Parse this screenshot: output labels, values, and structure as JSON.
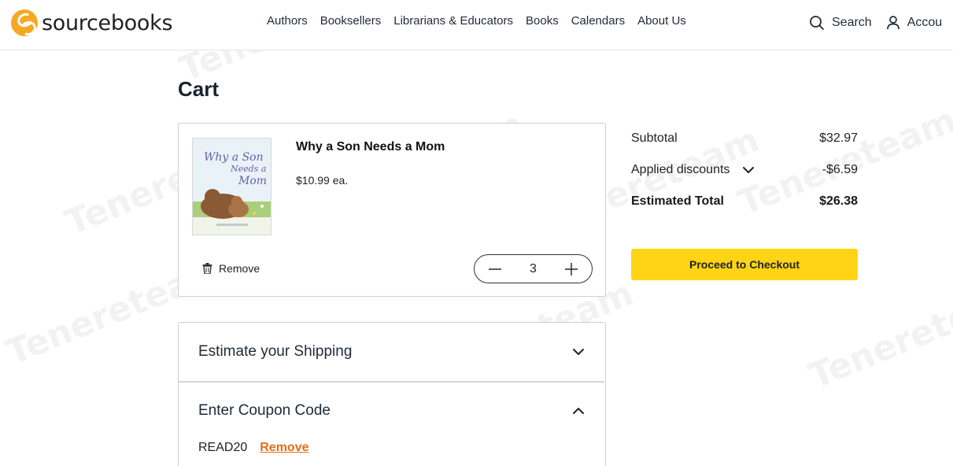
{
  "header": {
    "brand": "sourcebooks",
    "nav": [
      "Authors",
      "Booksellers",
      "Librarians & Educators",
      "Books",
      "Calendars",
      "About Us"
    ],
    "search_label": "Search",
    "account_label": "Accou"
  },
  "page": {
    "title": "Cart"
  },
  "cart_item": {
    "title": "Why a Son Needs a Mom",
    "price": "$10.99 ea.",
    "quantity": "3",
    "remove_label": "Remove",
    "cover_title_line1": "Why a Son",
    "cover_title_line2": "Needs a",
    "cover_title_line3": "Mom"
  },
  "summary": {
    "subtotal_label": "Subtotal",
    "subtotal_value": "$32.97",
    "discounts_label": "Applied discounts",
    "discounts_value": "-$6.59",
    "total_label": "Estimated Total",
    "total_value": "$26.38",
    "checkout_label": "Proceed to Checkout"
  },
  "shipping": {
    "label": "Estimate your Shipping"
  },
  "coupon": {
    "label": "Enter Coupon Code",
    "code": "READ20",
    "remove_label": "Remove"
  },
  "watermark": {
    "text": "Tenereteam"
  },
  "colors": {
    "brand_orange": "#f7a823",
    "checkout_yellow": "#ffd414",
    "remove_link": "#e46f19"
  },
  "icons": [
    "search-icon",
    "user-icon",
    "trash-icon",
    "minus-icon",
    "plus-icon",
    "chevron-down-icon",
    "chevron-up-icon"
  ]
}
